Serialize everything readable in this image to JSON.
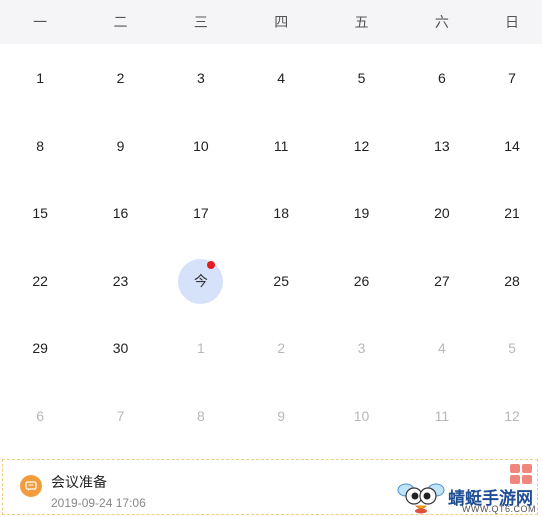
{
  "weekdays": [
    "一",
    "二",
    "三",
    "四",
    "五",
    "六",
    "日"
  ],
  "calendar": {
    "rows": [
      [
        {
          "d": "1",
          "muted": false
        },
        {
          "d": "2",
          "muted": false
        },
        {
          "d": "3",
          "muted": false
        },
        {
          "d": "4",
          "muted": false
        },
        {
          "d": "5",
          "muted": false
        },
        {
          "d": "6",
          "muted": false
        },
        {
          "d": "7",
          "muted": false
        }
      ],
      [
        {
          "d": "8",
          "muted": false
        },
        {
          "d": "9",
          "muted": false
        },
        {
          "d": "10",
          "muted": false
        },
        {
          "d": "11",
          "muted": false
        },
        {
          "d": "12",
          "muted": false
        },
        {
          "d": "13",
          "muted": false
        },
        {
          "d": "14",
          "muted": false
        }
      ],
      [
        {
          "d": "15",
          "muted": false
        },
        {
          "d": "16",
          "muted": false
        },
        {
          "d": "17",
          "muted": false
        },
        {
          "d": "18",
          "muted": false
        },
        {
          "d": "19",
          "muted": false
        },
        {
          "d": "20",
          "muted": false
        },
        {
          "d": "21",
          "muted": false
        }
      ],
      [
        {
          "d": "22",
          "muted": false
        },
        {
          "d": "23",
          "muted": false
        },
        {
          "d": "今",
          "muted": false,
          "today": true,
          "has_event": true
        },
        {
          "d": "25",
          "muted": false
        },
        {
          "d": "26",
          "muted": false
        },
        {
          "d": "27",
          "muted": false
        },
        {
          "d": "28",
          "muted": false
        }
      ],
      [
        {
          "d": "29",
          "muted": false
        },
        {
          "d": "30",
          "muted": false
        },
        {
          "d": "1",
          "muted": true
        },
        {
          "d": "2",
          "muted": true
        },
        {
          "d": "3",
          "muted": true
        },
        {
          "d": "4",
          "muted": true
        },
        {
          "d": "5",
          "muted": true
        }
      ],
      [
        {
          "d": "6",
          "muted": true
        },
        {
          "d": "7",
          "muted": true
        },
        {
          "d": "8",
          "muted": true
        },
        {
          "d": "9",
          "muted": true
        },
        {
          "d": "10",
          "muted": true
        },
        {
          "d": "11",
          "muted": true
        },
        {
          "d": "12",
          "muted": true
        }
      ]
    ]
  },
  "event": {
    "title": "会议准备",
    "datetime": "2019-09-24  17:06",
    "icon": "message-icon",
    "accent": "#f39c3d"
  },
  "watermark": {
    "title": "蜻蜓手游网",
    "url": "WWW.QT6.COM"
  },
  "colors": {
    "today_bg": "#d6e2fa",
    "today_dot": "#e51c23",
    "header_bg": "#f5f5f8",
    "muted_text": "#b8b8b8"
  }
}
